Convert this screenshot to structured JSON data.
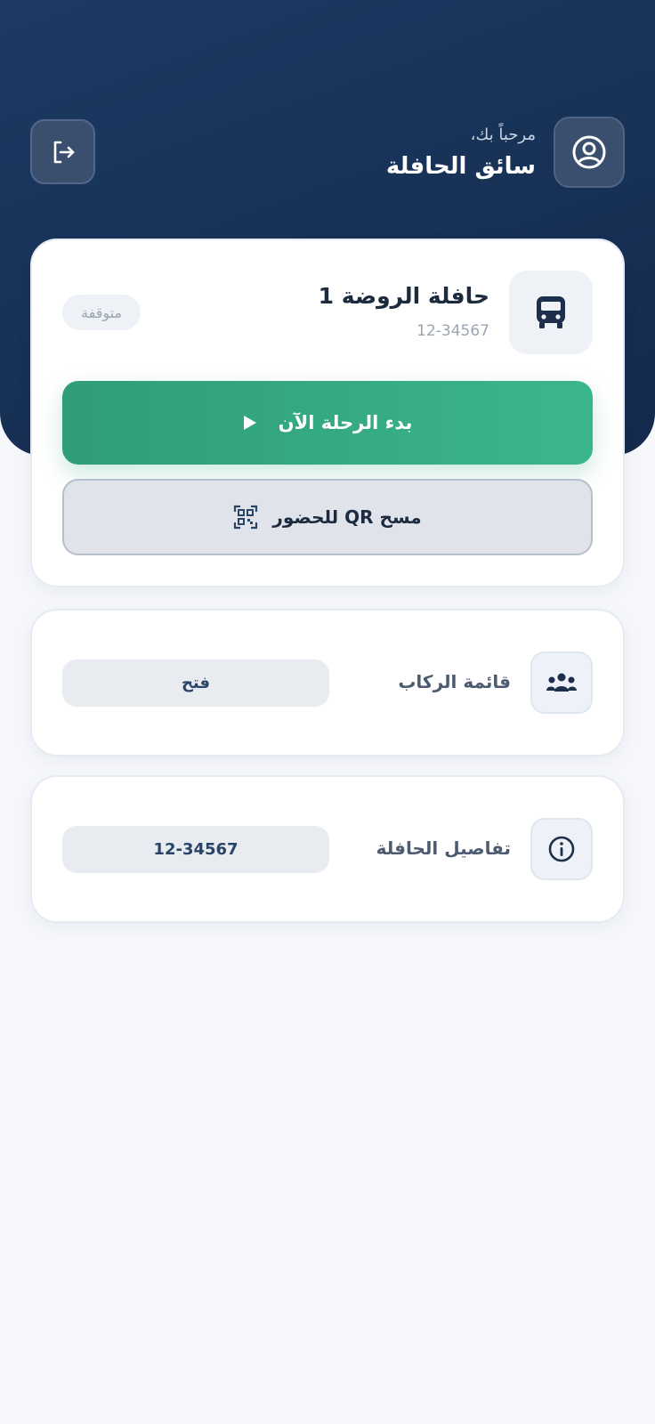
{
  "header": {
    "greeting": "مرحباً بك،",
    "user_name": "سائق الحافلة",
    "avatar_icon": "user-circle-icon",
    "logout_icon": "logout-icon"
  },
  "bus": {
    "title": "حافلة الروضة 1",
    "plate": "12-34567",
    "status": "متوقفة",
    "icon": "bus-icon"
  },
  "actions": {
    "start_trip_label": "بدء الرحلة الآن",
    "start_trip_icon": "play-icon",
    "scan_qr_label": "مسح QR للحضور",
    "scan_qr_icon": "qr-scan-icon"
  },
  "riders": {
    "label": "قائمة الركاب",
    "button_label": "فتح",
    "icon": "users-icon"
  },
  "bus_details": {
    "label": "تفاصيل الحافلة",
    "button_label": "12-34567",
    "icon": "info-icon"
  },
  "colors": {
    "header_bg": "#1c3a63",
    "accent_green": "#35aa80",
    "page_bg": "#f5f7fb"
  }
}
